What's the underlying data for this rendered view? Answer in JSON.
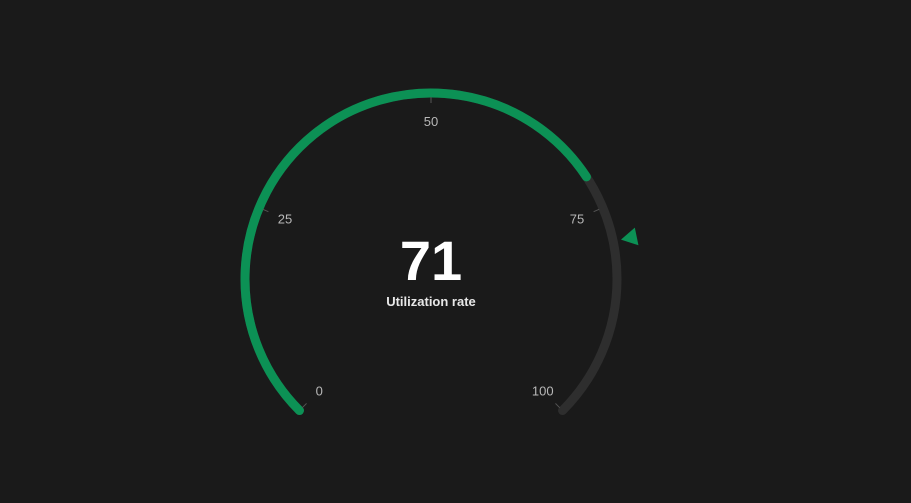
{
  "chart_data": {
    "type": "gauge",
    "value": 71,
    "value_label": "71",
    "caption": "Utilization rate",
    "min": 0,
    "max": 100,
    "target": 79,
    "ticks": [
      {
        "value": 0,
        "label": "0"
      },
      {
        "value": 25,
        "label": "25"
      },
      {
        "value": 50,
        "label": "50"
      },
      {
        "value": 75,
        "label": "75"
      },
      {
        "value": 100,
        "label": "100"
      }
    ]
  },
  "colors": {
    "background": "#1a1a1a",
    "fill": "#0c9155",
    "track": "#2e2e2e",
    "target_marker": "#0c9155",
    "tick_text": "#b8b8b8",
    "value_text": "#ffffff"
  }
}
